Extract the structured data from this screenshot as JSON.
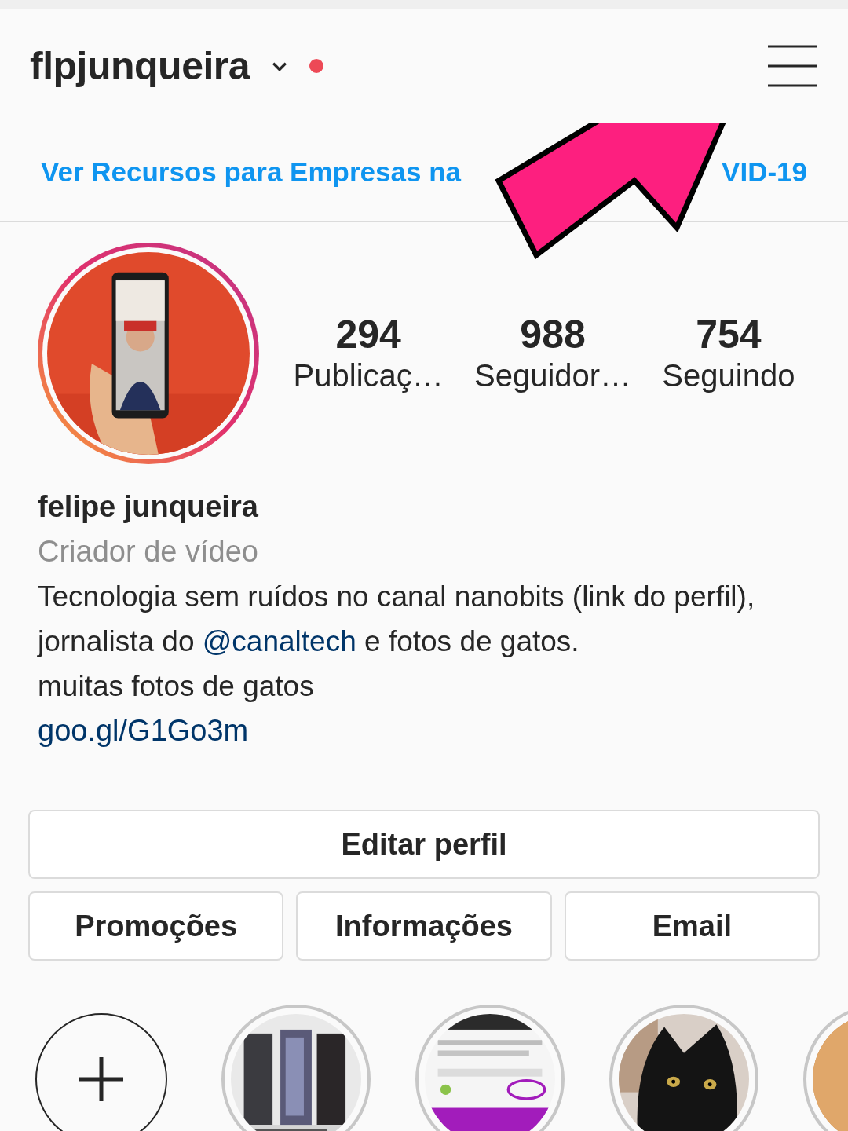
{
  "header": {
    "username": "flpjunqueira",
    "notification": true
  },
  "banner": {
    "text_parts": [
      "Ver Recursos para Empresas na",
      "VID-19"
    ]
  },
  "annotation_arrow": true,
  "profile": {
    "stats": [
      {
        "value": "294",
        "label": "Publicaç…"
      },
      {
        "value": "988",
        "label": "Seguidor…"
      },
      {
        "value": "754",
        "label": "Seguindo"
      }
    ],
    "name": "felipe junqueira",
    "category": "Criador de vídeo",
    "bio": {
      "before": "Tecnologia sem ruídos no canal nanobits (link do perfil), jornalista do ",
      "mention": "@canaltech",
      "after": " e fotos de gatos.",
      "last_line": "muitas fotos de gatos"
    },
    "website": "goo.gl/G1Go3m"
  },
  "edit_button": "Editar perfil",
  "actions": [
    "Promoções",
    "Informações",
    "Email"
  ],
  "highlights": [
    {
      "kind": "new"
    },
    {
      "kind": "picture"
    },
    {
      "kind": "picture"
    },
    {
      "kind": "picture"
    },
    {
      "kind": "picture"
    }
  ]
}
